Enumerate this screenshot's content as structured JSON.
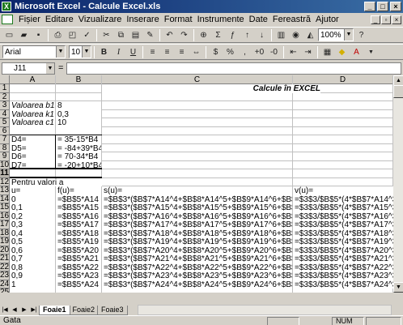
{
  "window": {
    "title": "Microsoft Excel - Calcule Excel.xls"
  },
  "menu": [
    "Fișier",
    "Editare",
    "Vizualizare",
    "Inserare",
    "Format",
    "Instrumente",
    "Date",
    "Fereastră",
    "Ajutor"
  ],
  "toolbar": {
    "zoom": "100%",
    "font": "Arial",
    "size": "10",
    "bold": "B",
    "italic": "I",
    "underline": "U"
  },
  "formula_bar": {
    "name_box": "J11",
    "eq": "="
  },
  "columns": [
    "A",
    "B",
    "C",
    "D"
  ],
  "rows": [
    {
      "n": "1",
      "a": "",
      "b": "",
      "c": "Calcule în EXCEL",
      "d": ""
    },
    {
      "n": "2",
      "a": "",
      "b": "",
      "c": "",
      "d": ""
    },
    {
      "n": "3",
      "a": "Valoarea b1",
      "b": "8",
      "c": "",
      "d": ""
    },
    {
      "n": "4",
      "a": "Valoarea k1",
      "b": "0,3",
      "c": "",
      "d": ""
    },
    {
      "n": "5",
      "a": "Valoarea c1",
      "b": "10",
      "c": "",
      "d": ""
    },
    {
      "n": "6",
      "a": "",
      "b": "",
      "c": "",
      "d": ""
    },
    {
      "n": "7",
      "a": "D4=",
      "b": "= 35-15*B4",
      "c": "",
      "d": ""
    },
    {
      "n": "8",
      "a": "D5=",
      "b": "= -84+39*B4",
      "c": "",
      "d": ""
    },
    {
      "n": "9",
      "a": "D6=",
      "b": "= 70-34*B4",
      "c": "",
      "d": ""
    },
    {
      "n": "10",
      "a": "D7=",
      "b": "= -20+10*B4",
      "c": "",
      "d": ""
    },
    {
      "n": "11",
      "a": "",
      "b": "",
      "c": "",
      "d": ""
    },
    {
      "n": "12",
      "a": "Pentru valori a",
      "b": "",
      "c": "",
      "d": ""
    },
    {
      "n": "13",
      "a": "u=",
      "b": "f(u)=",
      "c": "s(u)=",
      "d": "v(u)="
    },
    {
      "n": "14",
      "a": "0",
      "b": "=$B$5*A14",
      "c": "=$B$3*($B$7*A14^4+$B$8*A14^5+$B$9*A14^6+$B$10*A14^7)",
      "d": "=$3$3/$B$5*(4*$B$7*A14^3+5*$B"
    },
    {
      "n": "15",
      "a": "0,1",
      "b": "=$B$5*A15",
      "c": "=$B$3*($B$7*A15^4+$B$8*A15^5+$B$9*A15^6+$B$10*A15^7)",
      "d": "=$3$3/$B$5*(4*$B$7*A15^3+5*$B"
    },
    {
      "n": "16",
      "a": "0,2",
      "b": "=$B$5*A16",
      "c": "=$B$3*($B$7*A16^4+$B$8*A16^5+$B$9*A16^6+$B$10*A16^7)",
      "d": "=$3$3/$B$5*(4*$B$7*A16^3+5*$B"
    },
    {
      "n": "17",
      "a": "0,3",
      "b": "=$B$5*A17",
      "c": "=$B$3*($B$7*A17^4+$B$8*A17^5+$B$9*A17^6+$B$10*A17^7)",
      "d": "=$3$3/$B$5*(4*$B$7*A17^3+5*$B"
    },
    {
      "n": "18",
      "a": "0,4",
      "b": "=$B$5*A18",
      "c": "=$B$3*($B$7*A18^4+$B$8*A18^5+$B$9*A18^6+$B$10*A18^7)",
      "d": "=$3$3/$B$5*(4*$B$7*A18^3+5*$B"
    },
    {
      "n": "19",
      "a": "0,5",
      "b": "=$B$5*A19",
      "c": "=$B$3*($B$7*A19^4+$B$8*A19^5+$B$9*A19^6+$B$10*A19^7)",
      "d": "=$3$3/$B$5*(4*$B$7*A19^3+5*$B"
    },
    {
      "n": "20",
      "a": "0,6",
      "b": "=$B$5*A20",
      "c": "=$B$3*($B$7*A20^4+$B$8*A20^5+$B$9*A20^6+$B$10*A20^7)",
      "d": "=$3$3/$B$5*(4*$B$7*A20^3+5*$B"
    },
    {
      "n": "21",
      "a": "0,7",
      "b": "=$B$5*A21",
      "c": "=$B$3*($B$7*A21^4+$B$8*A21^5+$B$9*A21^6+$B$10*A21^7)",
      "d": "=$3$3/$B$5*(4*$B$7*A21^3+5*$B"
    },
    {
      "n": "22",
      "a": "0,8",
      "b": "=$B$5*A22",
      "c": "=$B$3*($B$7*A22^4+$B$8*A22^5+$B$9*A22^6+$B$10*A22^7)",
      "d": "=$3$3/$B$5*(4*$B$7*A22^3+5*$B"
    },
    {
      "n": "23",
      "a": "0,9",
      "b": "=$B$5*A23",
      "c": "=$B$3*($B$7*A23^4+$B$8*A23^5+$B$9*A23^6+$B$10*A23^7)",
      "d": "=$3$3/$B$5*(4*$B$7*A23^3+5*$B"
    },
    {
      "n": "24",
      "a": "1",
      "b": "=$B$5*A24",
      "c": "=$B$3*($B$7*A24^4+$B$8*A24^5+$B$9*A24^6+$B$10*A24^7)",
      "d": "=$3$3/$B$5*(4*$B$7*A24^3+5*$B"
    },
    {
      "n": "25",
      "a": "",
      "b": "",
      "c": "",
      "d": ""
    }
  ],
  "sheets": [
    "Foaie1",
    "Foaie2",
    "Foaie3"
  ],
  "status": {
    "left": "Gata",
    "num": "NUM"
  },
  "colors": {
    "title_start": "#0a246a",
    "title_end": "#3a6ea5",
    "chrome": "#d4d0c8"
  }
}
